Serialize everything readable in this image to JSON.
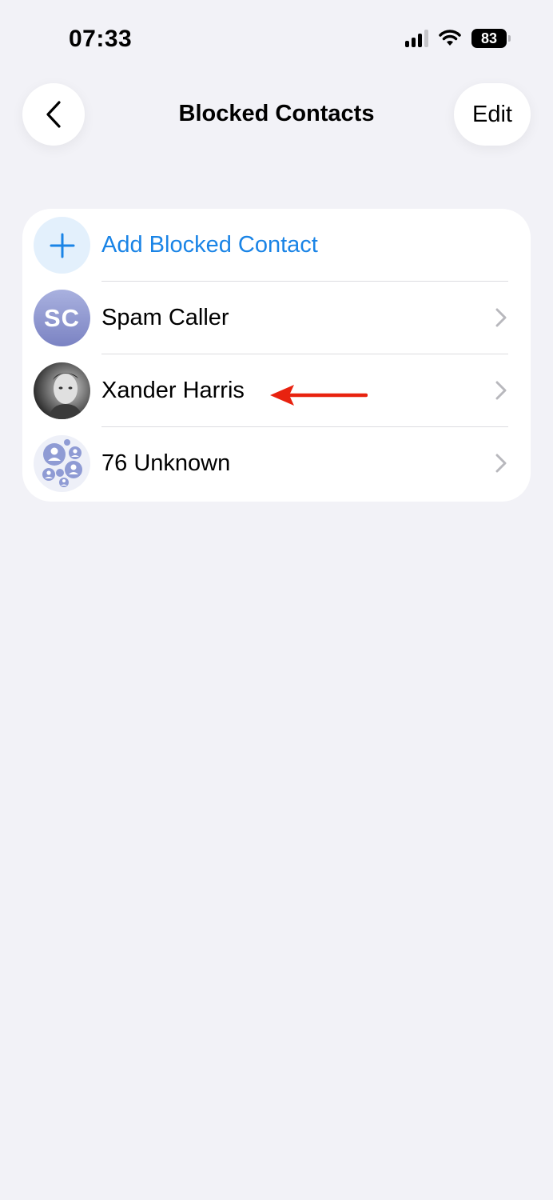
{
  "status_bar": {
    "time": "07:33",
    "battery": "83",
    "icons": [
      "signal-icon",
      "wifi-icon",
      "battery-icon"
    ]
  },
  "nav": {
    "title": "Blocked Contacts",
    "back_icon": "chevron-left-icon",
    "edit_label": "Edit"
  },
  "list": {
    "add_label": "Add Blocked Contact",
    "add_icon": "plus-icon",
    "contacts": [
      {
        "name": "Spam Caller",
        "initials": "SC",
        "avatar": "initials"
      },
      {
        "name": "Xander Harris",
        "avatar": "photo"
      },
      {
        "name": "76 Unknown",
        "avatar": "group-icon"
      }
    ]
  },
  "annotation": {
    "type": "arrow",
    "color": "#e8220f",
    "points_to": "Xander Harris"
  },
  "colors": {
    "accent": "#1a84e6",
    "background": "#f2f2f7",
    "card": "#ffffff"
  }
}
